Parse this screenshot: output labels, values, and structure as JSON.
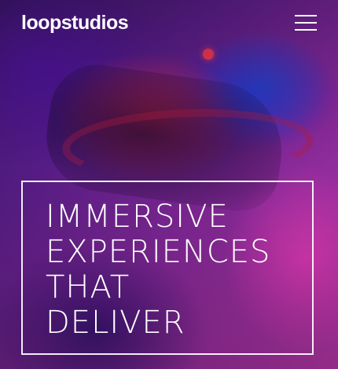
{
  "header": {
    "logo": "loopstudios",
    "menu_icon": "hamburger-menu-icon"
  },
  "hero": {
    "title_lines": [
      "IMMERSIVE",
      "EXPERIENCES",
      "THAT",
      "DELIVER"
    ]
  },
  "colors": {
    "text": "#ffffff",
    "accent_magenta": "#c33ab4",
    "accent_purple": "#5b1e8c"
  }
}
